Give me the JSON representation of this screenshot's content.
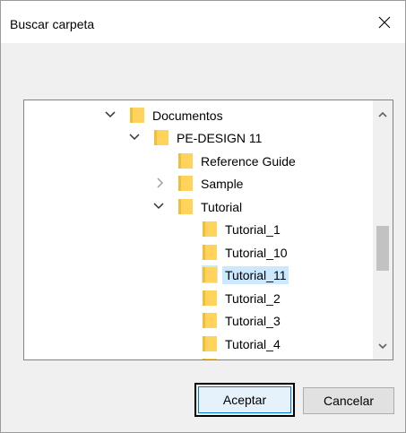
{
  "dialog": {
    "title": "Buscar carpeta",
    "close_icon": "close-icon"
  },
  "tree": {
    "items": [
      {
        "label": "Documentos",
        "state": "expanded",
        "selected": false
      },
      {
        "label": "PE-DESIGN 11",
        "state": "expanded",
        "selected": false
      },
      {
        "label": "Reference Guide",
        "state": "none",
        "selected": false
      },
      {
        "label": "Sample",
        "state": "collapsed",
        "selected": false
      },
      {
        "label": "Tutorial",
        "state": "expanded",
        "selected": false
      },
      {
        "label": "Tutorial_1",
        "state": "none",
        "selected": false
      },
      {
        "label": "Tutorial_10",
        "state": "none",
        "selected": false
      },
      {
        "label": "Tutorial_11",
        "state": "none",
        "selected": true
      },
      {
        "label": "Tutorial_2",
        "state": "none",
        "selected": false
      },
      {
        "label": "Tutorial_3",
        "state": "none",
        "selected": false
      },
      {
        "label": "Tutorial_4",
        "state": "none",
        "selected": false
      }
    ],
    "scroll_fraction": 0.55
  },
  "buttons": {
    "ok_label": "Aceptar",
    "cancel_label": "Cancelar"
  },
  "colors": {
    "selection": "#cce8ff",
    "folder": "#ffd35c",
    "accent": "#0078d7"
  }
}
